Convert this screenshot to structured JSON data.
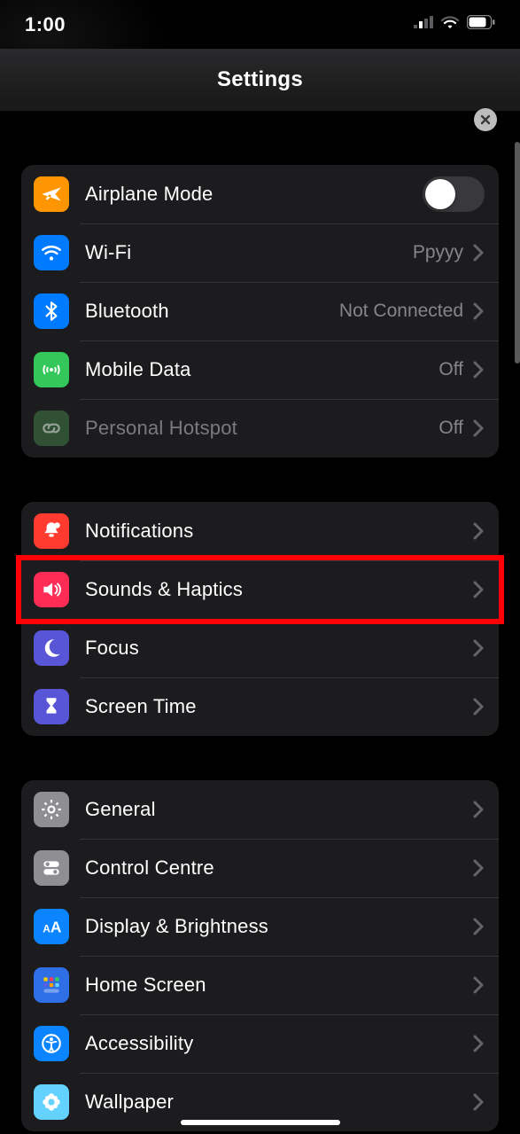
{
  "status": {
    "time": "1:00"
  },
  "navbar": {
    "title": "Settings"
  },
  "groups": [
    {
      "rows": [
        {
          "id": "airplane",
          "icon": "airplane-icon",
          "label": "Airplane Mode",
          "control": "switch",
          "switch_on": false
        },
        {
          "id": "wifi",
          "icon": "wifi-icon",
          "label": "Wi-Fi",
          "detail": "Ppyyy",
          "control": "disclosure"
        },
        {
          "id": "bluetooth",
          "icon": "bluetooth-icon",
          "label": "Bluetooth",
          "detail": "Not Connected",
          "control": "disclosure"
        },
        {
          "id": "mobiledata",
          "icon": "antenna-icon",
          "label": "Mobile Data",
          "detail": "Off",
          "control": "disclosure"
        },
        {
          "id": "hotspot",
          "icon": "link-icon",
          "label": "Personal Hotspot",
          "detail": "Off",
          "control": "disclosure",
          "disabled": true
        }
      ]
    },
    {
      "rows": [
        {
          "id": "notifications",
          "icon": "bell-icon",
          "label": "Notifications",
          "control": "disclosure"
        },
        {
          "id": "sounds",
          "icon": "speaker-icon",
          "label": "Sounds & Haptics",
          "control": "disclosure",
          "highlight": true
        },
        {
          "id": "focus",
          "icon": "moon-icon",
          "label": "Focus",
          "control": "disclosure"
        },
        {
          "id": "screentime",
          "icon": "hourglass-icon",
          "label": "Screen Time",
          "control": "disclosure"
        }
      ]
    },
    {
      "rows": [
        {
          "id": "general",
          "icon": "gear-icon",
          "label": "General",
          "control": "disclosure"
        },
        {
          "id": "controlcentre",
          "icon": "toggles-icon",
          "label": "Control Centre",
          "control": "disclosure"
        },
        {
          "id": "display",
          "icon": "textsize-icon",
          "label": "Display & Brightness",
          "control": "disclosure"
        },
        {
          "id": "homescreen",
          "icon": "grid-icon",
          "label": "Home Screen",
          "control": "disclosure"
        },
        {
          "id": "accessibility",
          "icon": "accessibility-icon",
          "label": "Accessibility",
          "control": "disclosure"
        },
        {
          "id": "wallpaper",
          "icon": "flower-icon",
          "label": "Wallpaper",
          "control": "disclosure"
        }
      ]
    }
  ]
}
